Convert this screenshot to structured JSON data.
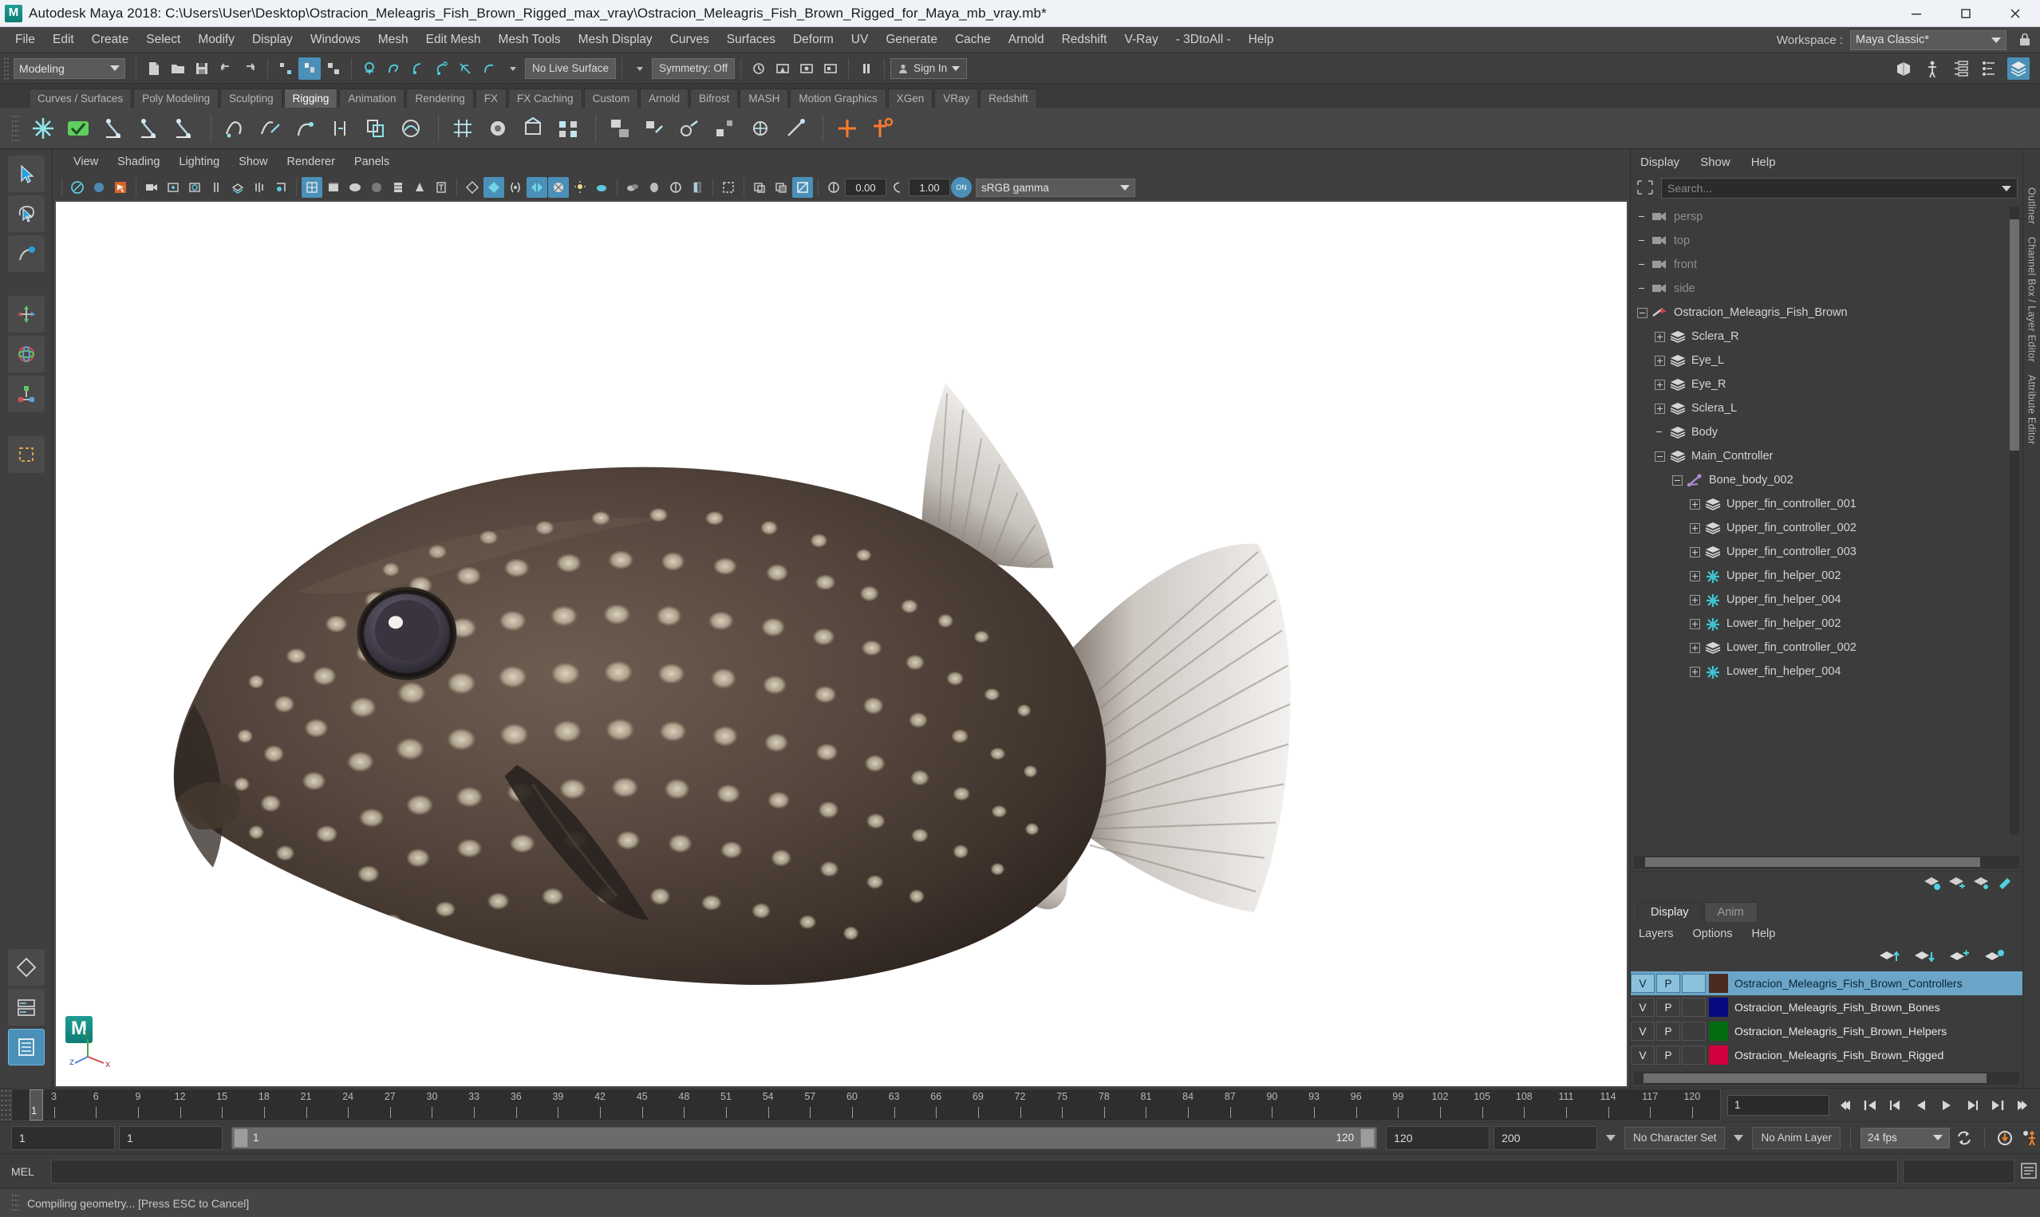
{
  "titlebar": {
    "app_title": "Autodesk Maya 2018: C:\\Users\\User\\Desktop\\Ostracion_Meleagris_Fish_Brown_Rigged_max_vray\\Ostracion_Meleagris_Fish_Brown_Rigged_for_Maya_mb_vray.mb*",
    "minimize": "minimize-icon",
    "maximize": "maximize-icon",
    "close": "close-icon"
  },
  "menubar": {
    "items": [
      "File",
      "Edit",
      "Create",
      "Select",
      "Modify",
      "Display",
      "Windows",
      "Mesh",
      "Edit Mesh",
      "Mesh Tools",
      "Mesh Display",
      "Curves",
      "Surfaces",
      "Deform",
      "UV",
      "Generate",
      "Cache",
      "Arnold",
      "Redshift",
      "V-Ray",
      "- 3DtoAll -",
      "Help"
    ],
    "workspace_label": "Workspace :",
    "workspace_value": "Maya Classic*"
  },
  "statusline": {
    "mode": "Modeling",
    "live_surface": "No Live Surface",
    "symmetry": "Symmetry: Off",
    "signin": "Sign In"
  },
  "shelf": {
    "tabs": [
      "Curves / Surfaces",
      "Poly Modeling",
      "Sculpting",
      "Rigging",
      "Animation",
      "Rendering",
      "FX",
      "FX Caching",
      "Custom",
      "Arnold",
      "Bifrost",
      "MASH",
      "Motion Graphics",
      "XGen",
      "VRay",
      "Redshift"
    ],
    "active_tab": "Rigging"
  },
  "viewport_menu": {
    "items": [
      "View",
      "Shading",
      "Lighting",
      "Show",
      "Renderer",
      "Panels"
    ]
  },
  "viewport_toolbar": {
    "exposure_value": "0.00",
    "gamma_value": "1.00",
    "color_space": "sRGB gamma",
    "cm_toggle": "ON"
  },
  "viewport": {
    "axis_x": "x",
    "axis_y": "y",
    "axis_z": "z"
  },
  "outliner": {
    "menus": [
      "Display",
      "Show",
      "Help"
    ],
    "search_placeholder": "Search...",
    "search_value": "",
    "panel_tab_label": "Outliner",
    "items": [
      {
        "label": "persp",
        "depth": 0,
        "icon": "camera-icon",
        "expander": "none",
        "dim": true
      },
      {
        "label": "top",
        "depth": 0,
        "icon": "camera-icon",
        "expander": "none",
        "dim": true
      },
      {
        "label": "front",
        "depth": 0,
        "icon": "camera-icon",
        "expander": "none",
        "dim": true
      },
      {
        "label": "side",
        "depth": 0,
        "icon": "camera-icon",
        "expander": "none",
        "dim": true
      },
      {
        "label": "Ostracion_Meleagris_Fish_Brown",
        "depth": 0,
        "icon": "group-arrow-icon",
        "expander": "minus",
        "dim": false
      },
      {
        "label": "Sclera_R",
        "depth": 1,
        "icon": "mesh-icon",
        "expander": "plus",
        "dim": false
      },
      {
        "label": "Eye_L",
        "depth": 1,
        "icon": "mesh-icon",
        "expander": "plus",
        "dim": false
      },
      {
        "label": "Eye_R",
        "depth": 1,
        "icon": "mesh-icon",
        "expander": "plus",
        "dim": false
      },
      {
        "label": "Sclera_L",
        "depth": 1,
        "icon": "mesh-icon",
        "expander": "plus",
        "dim": false
      },
      {
        "label": "Body",
        "depth": 1,
        "icon": "mesh-icon",
        "expander": "none",
        "dim": false
      },
      {
        "label": "Main_Controller",
        "depth": 1,
        "icon": "mesh-icon",
        "expander": "minus",
        "dim": false
      },
      {
        "label": "Bone_body_002",
        "depth": 2,
        "icon": "joint-icon",
        "expander": "minus",
        "dim": false
      },
      {
        "label": "Upper_fin_controller_001",
        "depth": 3,
        "icon": "mesh-icon",
        "expander": "plus",
        "dim": false
      },
      {
        "label": "Upper_fin_controller_002",
        "depth": 3,
        "icon": "mesh-icon",
        "expander": "plus",
        "dim": false
      },
      {
        "label": "Upper_fin_controller_003",
        "depth": 3,
        "icon": "mesh-icon",
        "expander": "plus",
        "dim": false
      },
      {
        "label": "Upper_fin_helper_002",
        "depth": 3,
        "icon": "locator-icon",
        "expander": "plus",
        "dim": false
      },
      {
        "label": "Upper_fin_helper_004",
        "depth": 3,
        "icon": "locator-icon",
        "expander": "plus",
        "dim": false
      },
      {
        "label": "Lower_fin_helper_002",
        "depth": 3,
        "icon": "locator-icon",
        "expander": "plus",
        "dim": false
      },
      {
        "label": "Lower_fin_controller_002",
        "depth": 3,
        "icon": "mesh-icon",
        "expander": "plus",
        "dim": false
      },
      {
        "label": "Lower_fin_helper_004",
        "depth": 3,
        "icon": "locator-icon",
        "expander": "plus",
        "dim": false
      }
    ]
  },
  "layer_editor": {
    "tabs": [
      "Display",
      "Anim"
    ],
    "active_tab": "Display",
    "menus": [
      "Layers",
      "Options",
      "Help"
    ],
    "panel_tab_label": "Channel Box / Layer Editor",
    "attribute_tab_label": "Attribute Editor",
    "columns": {
      "visible": "V",
      "playback": "P"
    },
    "layers": [
      {
        "v": "V",
        "p": "P",
        "color": "#4a2b22",
        "name": "Ostracion_Meleagris_Fish_Brown_Controllers",
        "selected": true
      },
      {
        "v": "V",
        "p": "P",
        "color": "#090a7f",
        "name": "Ostracion_Meleagris_Fish_Brown_Bones",
        "selected": false
      },
      {
        "v": "V",
        "p": "P",
        "color": "#046b12",
        "name": "Ostracion_Meleagris_Fish_Brown_Helpers",
        "selected": false
      },
      {
        "v": "V",
        "p": "P",
        "color": "#d2003c",
        "name": "Ostracion_Meleagris_Fish_Brown_Rigged",
        "selected": false
      }
    ]
  },
  "timeline": {
    "ticks": [
      3,
      6,
      9,
      12,
      15,
      18,
      21,
      24,
      27,
      30,
      33,
      36,
      39,
      42,
      45,
      48,
      51,
      54,
      57,
      60,
      63,
      66,
      69,
      72,
      75,
      78,
      81,
      84,
      87,
      90,
      93,
      96,
      99,
      102,
      105,
      108,
      111,
      114,
      117,
      120
    ],
    "current_frame": "1",
    "frame_field": "1"
  },
  "range_slider": {
    "start_field": "1",
    "current_field": "1",
    "range_start": "1",
    "range_end": "120",
    "anim_end": "120",
    "playback_end": "200",
    "character_set": "No Character Set",
    "anim_layer": "No Anim Layer",
    "fps": "24 fps"
  },
  "mel": {
    "label": "MEL",
    "command_value": "",
    "placeholder": ""
  },
  "statusbar": {
    "message": "Compiling geometry... [Press ESC to Cancel]"
  },
  "colors": {
    "accent_blue": "#4a90b8",
    "panel_bg": "#3c3c3c",
    "menu_bg": "#444444",
    "title_bg": "#eff3f7",
    "viewport_bg": "#ffffff"
  }
}
